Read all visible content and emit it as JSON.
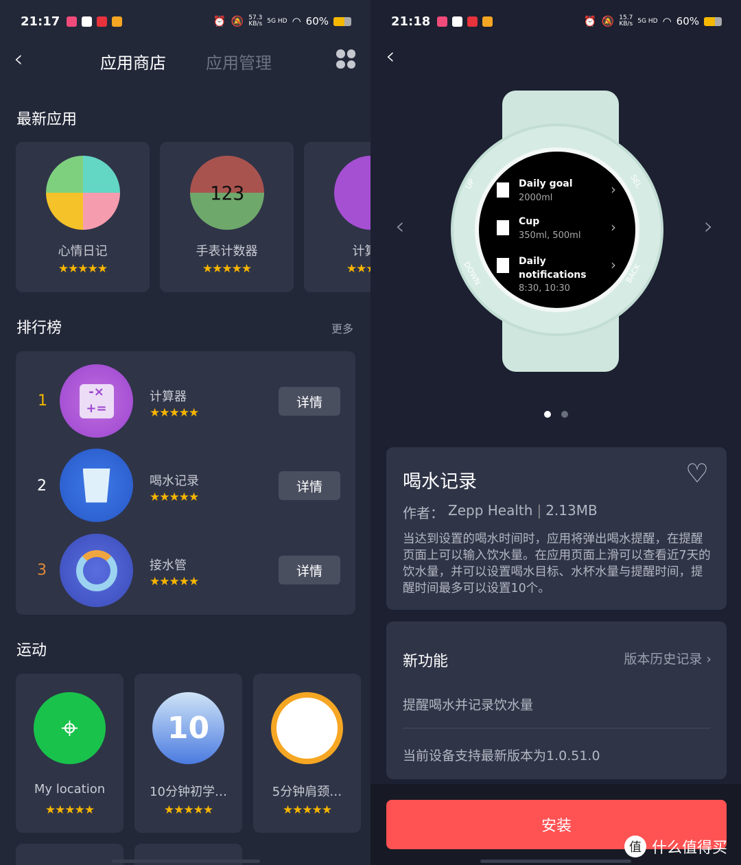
{
  "left": {
    "status": {
      "time": "21:17",
      "speed": "57.3",
      "speed_unit": "KB/s",
      "network": "5G HD",
      "battery": "60%",
      "battery_level": 0.6
    },
    "tabs": [
      {
        "label": "应用商店",
        "active": true
      },
      {
        "label": "应用管理",
        "active": false
      }
    ],
    "sections": {
      "newest": "最新应用",
      "ranking": "排行榜",
      "more": "更多",
      "sports": "运动"
    },
    "newest_apps": [
      {
        "name": "心情日记",
        "rating": 5
      },
      {
        "name": "手表计数器",
        "rating": 5,
        "icon_text": "123"
      },
      {
        "name": "计算器",
        "rating": 5
      }
    ],
    "ranking": [
      {
        "rank": "1",
        "name": "计算器",
        "rating": 5,
        "button": "详情",
        "rank_color": "#f5b800"
      },
      {
        "rank": "2",
        "name": "喝水记录",
        "rating": 5,
        "button": "详情",
        "rank_color": "#ffffff"
      },
      {
        "rank": "3",
        "name": "接水管",
        "rating": 5,
        "button": "详情",
        "rank_color": "#e08a3a"
      }
    ],
    "sports_apps": [
      {
        "name": "My location",
        "rating": 5
      },
      {
        "name": "10分钟初学…",
        "rating": 5,
        "icon_text": "10"
      },
      {
        "name": "5分钟肩颈…",
        "rating": 5
      }
    ]
  },
  "right": {
    "status": {
      "time": "21:18",
      "speed": "15.7",
      "speed_unit": "KB/s",
      "network": "5G HD",
      "battery": "60%",
      "battery_level": 0.6
    },
    "watch": {
      "bezel_labels": {
        "up": "UP",
        "sel": "SEL",
        "down": "DOWN",
        "back": "BACK"
      },
      "items": [
        {
          "title": "Daily goal",
          "sub": "2000ml"
        },
        {
          "title": "Cup",
          "sub": "350ml, 500ml"
        },
        {
          "title": "Daily notifications",
          "sub": "8:30, 10:30"
        }
      ]
    },
    "carousel": {
      "pages": 2,
      "active": 1
    },
    "app": {
      "name": "喝水记录",
      "author_label": "作者：",
      "author": "Zepp Health",
      "size": "2.13MB",
      "description": "当达到设置的喝水时间时，应用将弹出喝水提醒，在提醒页面上可以输入饮水量。在应用页面上滑可以查看近7天的饮水量，并可以设置喝水目标、水杯水量与提醒时间，提醒时间最多可以设置10个。"
    },
    "features": {
      "title": "新功能",
      "history": "版本历史记录",
      "new_feature": "提醒喝水并记录饮水量",
      "version_note": "当前设备支持最新版本为1.0.51.0"
    },
    "install": "安装",
    "install_color": "#ff5253",
    "watermark": "什么值得买"
  }
}
